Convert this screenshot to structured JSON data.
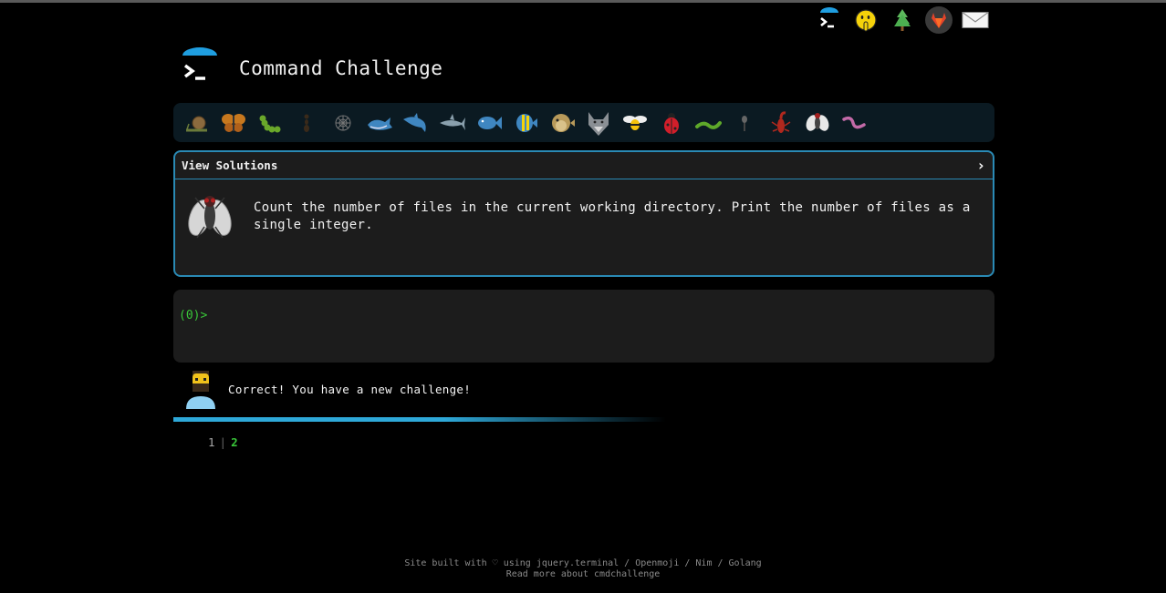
{
  "app": {
    "title": "Command Challenge"
  },
  "top_icons": [
    "terminal-icon",
    "shushing-face-icon",
    "tree-icon",
    "gitlab-icon",
    "mail-icon"
  ],
  "creatures": [
    "snail-icon",
    "butterfly-icon",
    "caterpillar-icon",
    "ant-icon",
    "spider-web-icon",
    "whale-icon",
    "dolphin-icon",
    "shark-icon",
    "fish-icon",
    "tropical-fish-icon",
    "blowfish-icon",
    "wolf-icon",
    "bee-icon",
    "ladybug-icon",
    "worm-icon",
    "mosquito-icon",
    "scorpion-icon",
    "fly-icon",
    "centipede-icon"
  ],
  "challenge": {
    "toggle_label": "View Solutions",
    "chevron": "›",
    "description": "Count the number of files in the current working directory. Print the number of files as a single integer."
  },
  "terminal": {
    "prompt": "(0)>"
  },
  "feedback": {
    "message": "Correct! You have a new challenge!"
  },
  "pager": {
    "page1": "1",
    "separator": "|",
    "page2": "2"
  },
  "footer": {
    "line1": "Site built with ♡ using jquery.terminal / Openmoji / Nim / Golang",
    "line2": "Read more about cmdchallenge"
  },
  "colors": {
    "accent": "#2a8ab5",
    "prompt_green": "#39c639"
  }
}
